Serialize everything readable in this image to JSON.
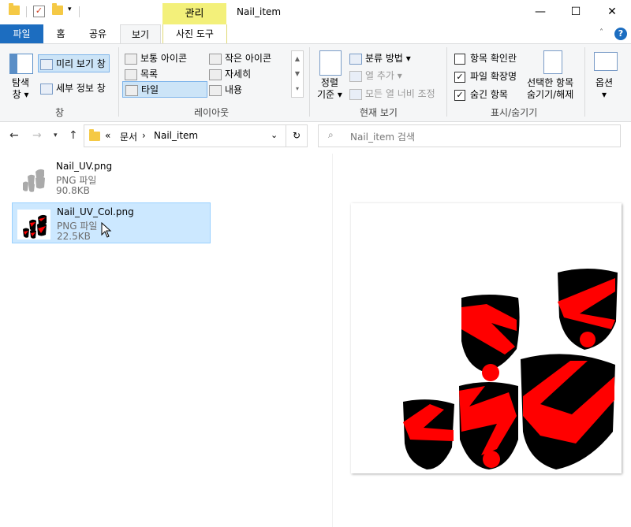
{
  "window": {
    "title": "Nail_item",
    "context_tab": "관리",
    "minimize": "—",
    "maximize": "☐",
    "close": "✕"
  },
  "ribbon_tabs": [
    "파일",
    "홈",
    "공유",
    "보기",
    "사진 도구"
  ],
  "ribbon": {
    "pane_group": {
      "nav_pane": "탐색\n창",
      "nav_pane_l1": "탐색",
      "nav_pane_l2": "창",
      "preview_pane": "미리 보기 창",
      "details_pane": "세부 정보 창",
      "label": "창"
    },
    "layout_group": {
      "items": [
        "보통 아이콘",
        "작은 아이콘",
        "목록",
        "자세히",
        "타일",
        "내용"
      ],
      "selected": "타일",
      "label": "레이아웃"
    },
    "current_view_group": {
      "sort_l1": "정렬",
      "sort_l2": "기준",
      "group_by": "분류 방법",
      "add_columns": "열 추가",
      "size_all_columns": "모든 열 너비 조정",
      "label": "현재 보기"
    },
    "show_hide_group": {
      "item_checkboxes": "항목 확인란",
      "item_checkboxes_checked": false,
      "file_extensions": "파일 확장명",
      "file_extensions_checked": true,
      "hidden_items": "숨긴 항목",
      "hidden_items_checked": true,
      "hide_selected_l1": "선택한 항목",
      "hide_selected_l2": "숨기기/해제",
      "label": "표시/숨기기"
    },
    "options": "옵션"
  },
  "address": {
    "overflow": "«",
    "crumbs": [
      "문서",
      "Nail_item"
    ],
    "search_placeholder": "Nail_item 검색"
  },
  "files": [
    {
      "name": "Nail_UV.png",
      "type": "PNG 파일",
      "size": "90.8KB",
      "selected": false
    },
    {
      "name": "Nail_UV_Col.png",
      "type": "PNG 파일",
      "size": "22.5KB",
      "selected": true
    }
  ],
  "colors": {
    "accent": "#1c6dc0",
    "context_tab": "#f3f07a",
    "selection": "#cce8ff",
    "nail_red": "#ff0000",
    "nail_black": "#000000"
  }
}
